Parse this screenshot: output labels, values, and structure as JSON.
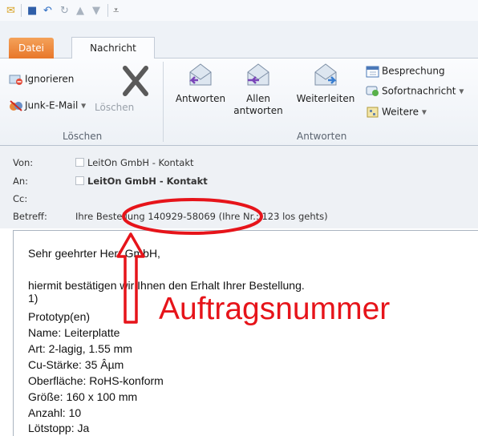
{
  "ribbon": {
    "tab_file": "Datei",
    "tab_message": "Nachricht",
    "ignore": "Ignorieren",
    "junk": "Junk-E-Mail",
    "delete": "Löschen",
    "group_delete": "Löschen",
    "reply": "Antworten",
    "reply_all_1": "Allen",
    "reply_all_2": "antworten",
    "forward": "Weiterleiten",
    "group_reply": "Antworten",
    "meeting": "Besprechung",
    "im": "Sofortnachricht",
    "more": "Weitere"
  },
  "header": {
    "from_label": "Von:",
    "from_value": "LeitOn GmbH - Kontakt",
    "to_label": "An:",
    "to_value": "LeitOn GmbH - Kontakt",
    "cc_label": "Cc:",
    "subject_label": "Betreff:",
    "subject_value": "Ihre Bestellung 140929-58069 (Ihre Nr.: 123 los gehts)"
  },
  "body": {
    "lines": [
      "Sehr geehrter Herr GmbH,",
      "hiermit bestätigen wir Ihnen den Erhalt Ihrer Bestellung.",
      "1)",
      "Prototyp(en)",
      "Name:     Leiterplatte",
      "Art:     2-lagig, 1.55 mm",
      "Cu-Stärke: 35 Âµm",
      "Oberfläche: RoHS-konform",
      "Größe:     160 x 100 mm",
      "Anzahl:   10",
      "Lötstopp:  Ja"
    ]
  },
  "annotation": {
    "label": "Auftragsnummer",
    "color": "#e6141a"
  }
}
